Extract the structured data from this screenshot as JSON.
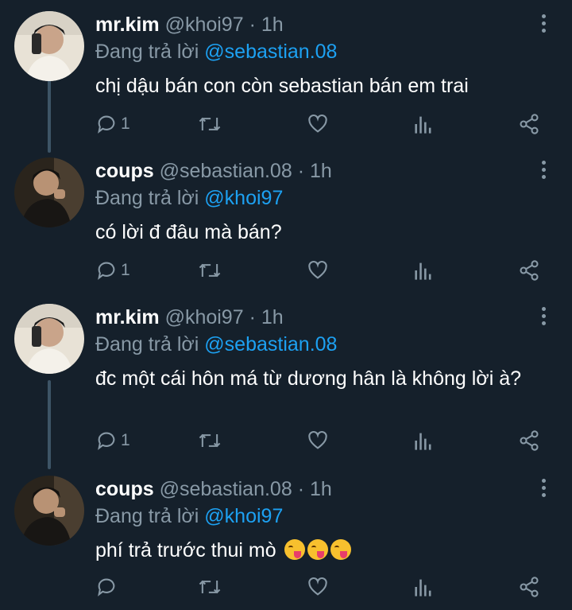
{
  "tweets": [
    {
      "name": "mr.kim",
      "handle": "@khoi97",
      "dot": "·",
      "time": "1h",
      "reply_prefix": "Đang trả lời",
      "reply_to": "@sebastian.08",
      "text": "chị dậu bán con còn sebastian bán em trai",
      "reply_count": "1",
      "avatar": "avatar-mr-kim"
    },
    {
      "name": "coups",
      "handle": "@sebastian.08",
      "dot": "·",
      "time": "1h",
      "reply_prefix": "Đang trả lời",
      "reply_to": "@khoi97",
      "text": "có lời đ đâu mà bán?",
      "reply_count": "1",
      "avatar": "avatar-coups"
    },
    {
      "name": "mr.kim",
      "handle": "@khoi97",
      "dot": "·",
      "time": "1h",
      "reply_prefix": "Đang trả lời",
      "reply_to": "@sebastian.08",
      "text": "đc một cái hôn má từ dương hân là không lời à?",
      "reply_count": "1",
      "avatar": "avatar-mr-kim"
    },
    {
      "name": "coups",
      "handle": "@sebastian.08",
      "dot": "·",
      "time": "1h",
      "reply_prefix": "Đang trả lời",
      "reply_to": "@khoi97",
      "text": "phí trả trước thui mò",
      "emoji_count": 3,
      "emoji_name": "face-savoring-food-emoji",
      "reply_count": "",
      "avatar": "avatar-coups"
    }
  ],
  "icons": {
    "reply": "reply-icon",
    "retweet": "retweet-icon",
    "like": "like-icon",
    "analytics": "analytics-icon",
    "share": "share-icon",
    "more": "more-options-icon"
  },
  "colors": {
    "background": "#15202b",
    "secondary_text": "#8899a6",
    "mention": "#1da1f2",
    "thread_line": "#3d5466"
  }
}
